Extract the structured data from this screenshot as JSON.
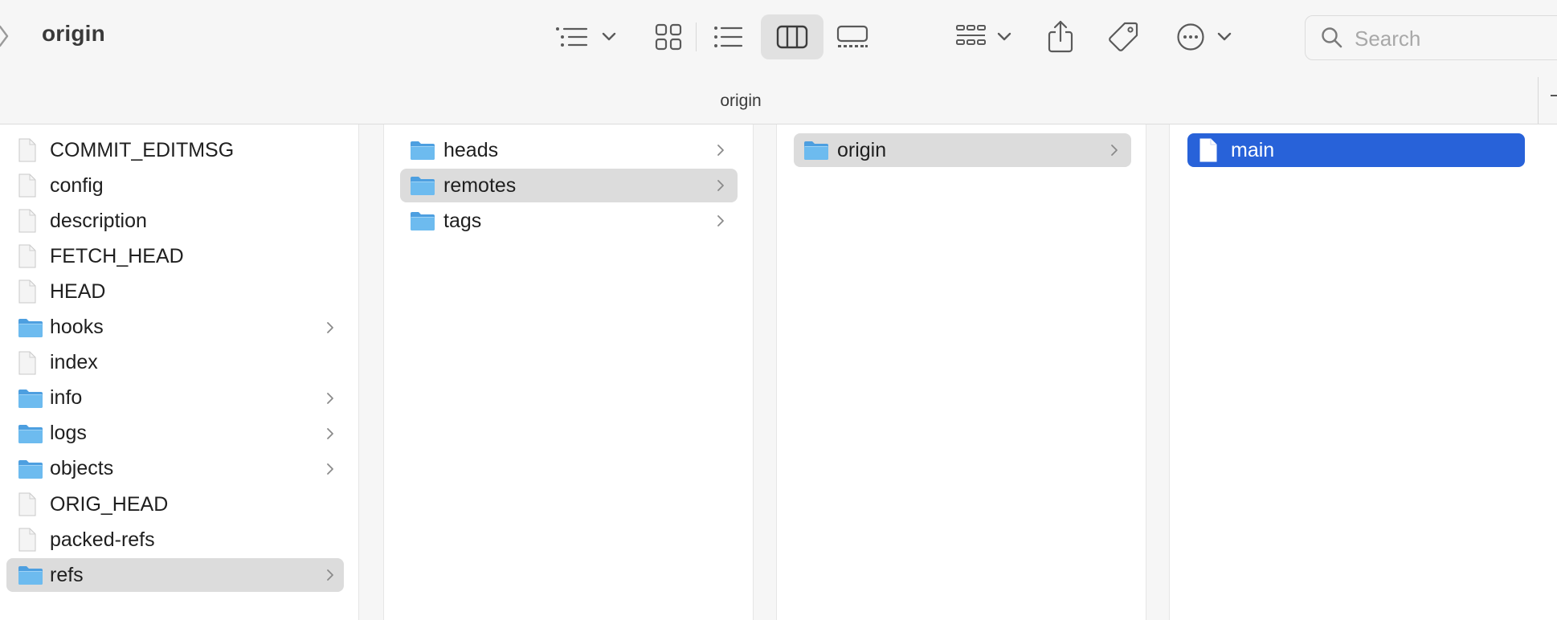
{
  "window": {
    "title": "origin"
  },
  "toolbar": {
    "icons": [
      "sidebar-list-icon",
      "chevron-down-icon",
      "icon-view-icon",
      "list-view-icon",
      "column-view-icon",
      "gallery-view-icon",
      "group-icon",
      "share-icon",
      "tag-icon",
      "more-icon"
    ],
    "active_view": "columns"
  },
  "search": {
    "placeholder": "Search"
  },
  "pathbar": {
    "label": "origin"
  },
  "colors": {
    "selection_blue": "#2862d9",
    "selection_gray": "#dcdcdc",
    "folder_blue": "#62b3ea"
  },
  "columns": [
    {
      "items": [
        {
          "label": "COMMIT_EDITMSG",
          "kind": "file"
        },
        {
          "label": "config",
          "kind": "file"
        },
        {
          "label": "description",
          "kind": "file"
        },
        {
          "label": "FETCH_HEAD",
          "kind": "file"
        },
        {
          "label": "HEAD",
          "kind": "file"
        },
        {
          "label": "hooks",
          "kind": "folder"
        },
        {
          "label": "index",
          "kind": "file"
        },
        {
          "label": "info",
          "kind": "folder"
        },
        {
          "label": "logs",
          "kind": "folder"
        },
        {
          "label": "objects",
          "kind": "folder"
        },
        {
          "label": "ORIG_HEAD",
          "kind": "file"
        },
        {
          "label": "packed-refs",
          "kind": "file"
        },
        {
          "label": "refs",
          "kind": "folder",
          "selected": "path"
        }
      ]
    },
    {
      "items": [
        {
          "label": "heads",
          "kind": "folder"
        },
        {
          "label": "remotes",
          "kind": "folder",
          "selected": "path"
        },
        {
          "label": "tags",
          "kind": "folder"
        }
      ]
    },
    {
      "items": [
        {
          "label": "origin",
          "kind": "folder",
          "selected": "path"
        }
      ]
    },
    {
      "items": [
        {
          "label": "main",
          "kind": "file",
          "selected": "active"
        }
      ]
    }
  ]
}
